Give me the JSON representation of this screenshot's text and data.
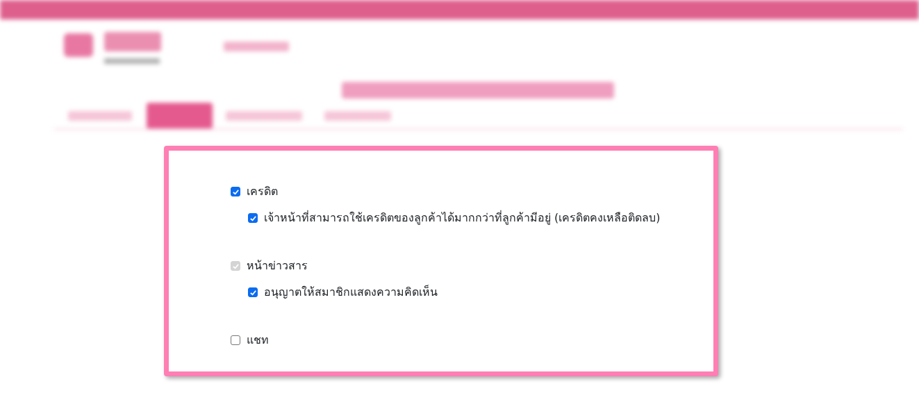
{
  "settings": [
    {
      "label": "เครดิต",
      "checked": true,
      "disabled": false,
      "children": [
        {
          "label": "เจ้าหน้าที่สามารถใช้เครดิตของลูกค้าได้มากกว่าที่ลูกค้ามีอยู่ (เครดิตคงเหลือติดลบ)",
          "checked": true,
          "disabled": false
        }
      ]
    },
    {
      "label": "หน้าข่าวสาร",
      "checked": true,
      "disabled": true,
      "children": [
        {
          "label": "อนุญาตให้สมาชิกแสดงความคิดเห็น",
          "checked": true,
          "disabled": false
        }
      ]
    },
    {
      "label": "แชท",
      "checked": false,
      "disabled": false
    }
  ]
}
